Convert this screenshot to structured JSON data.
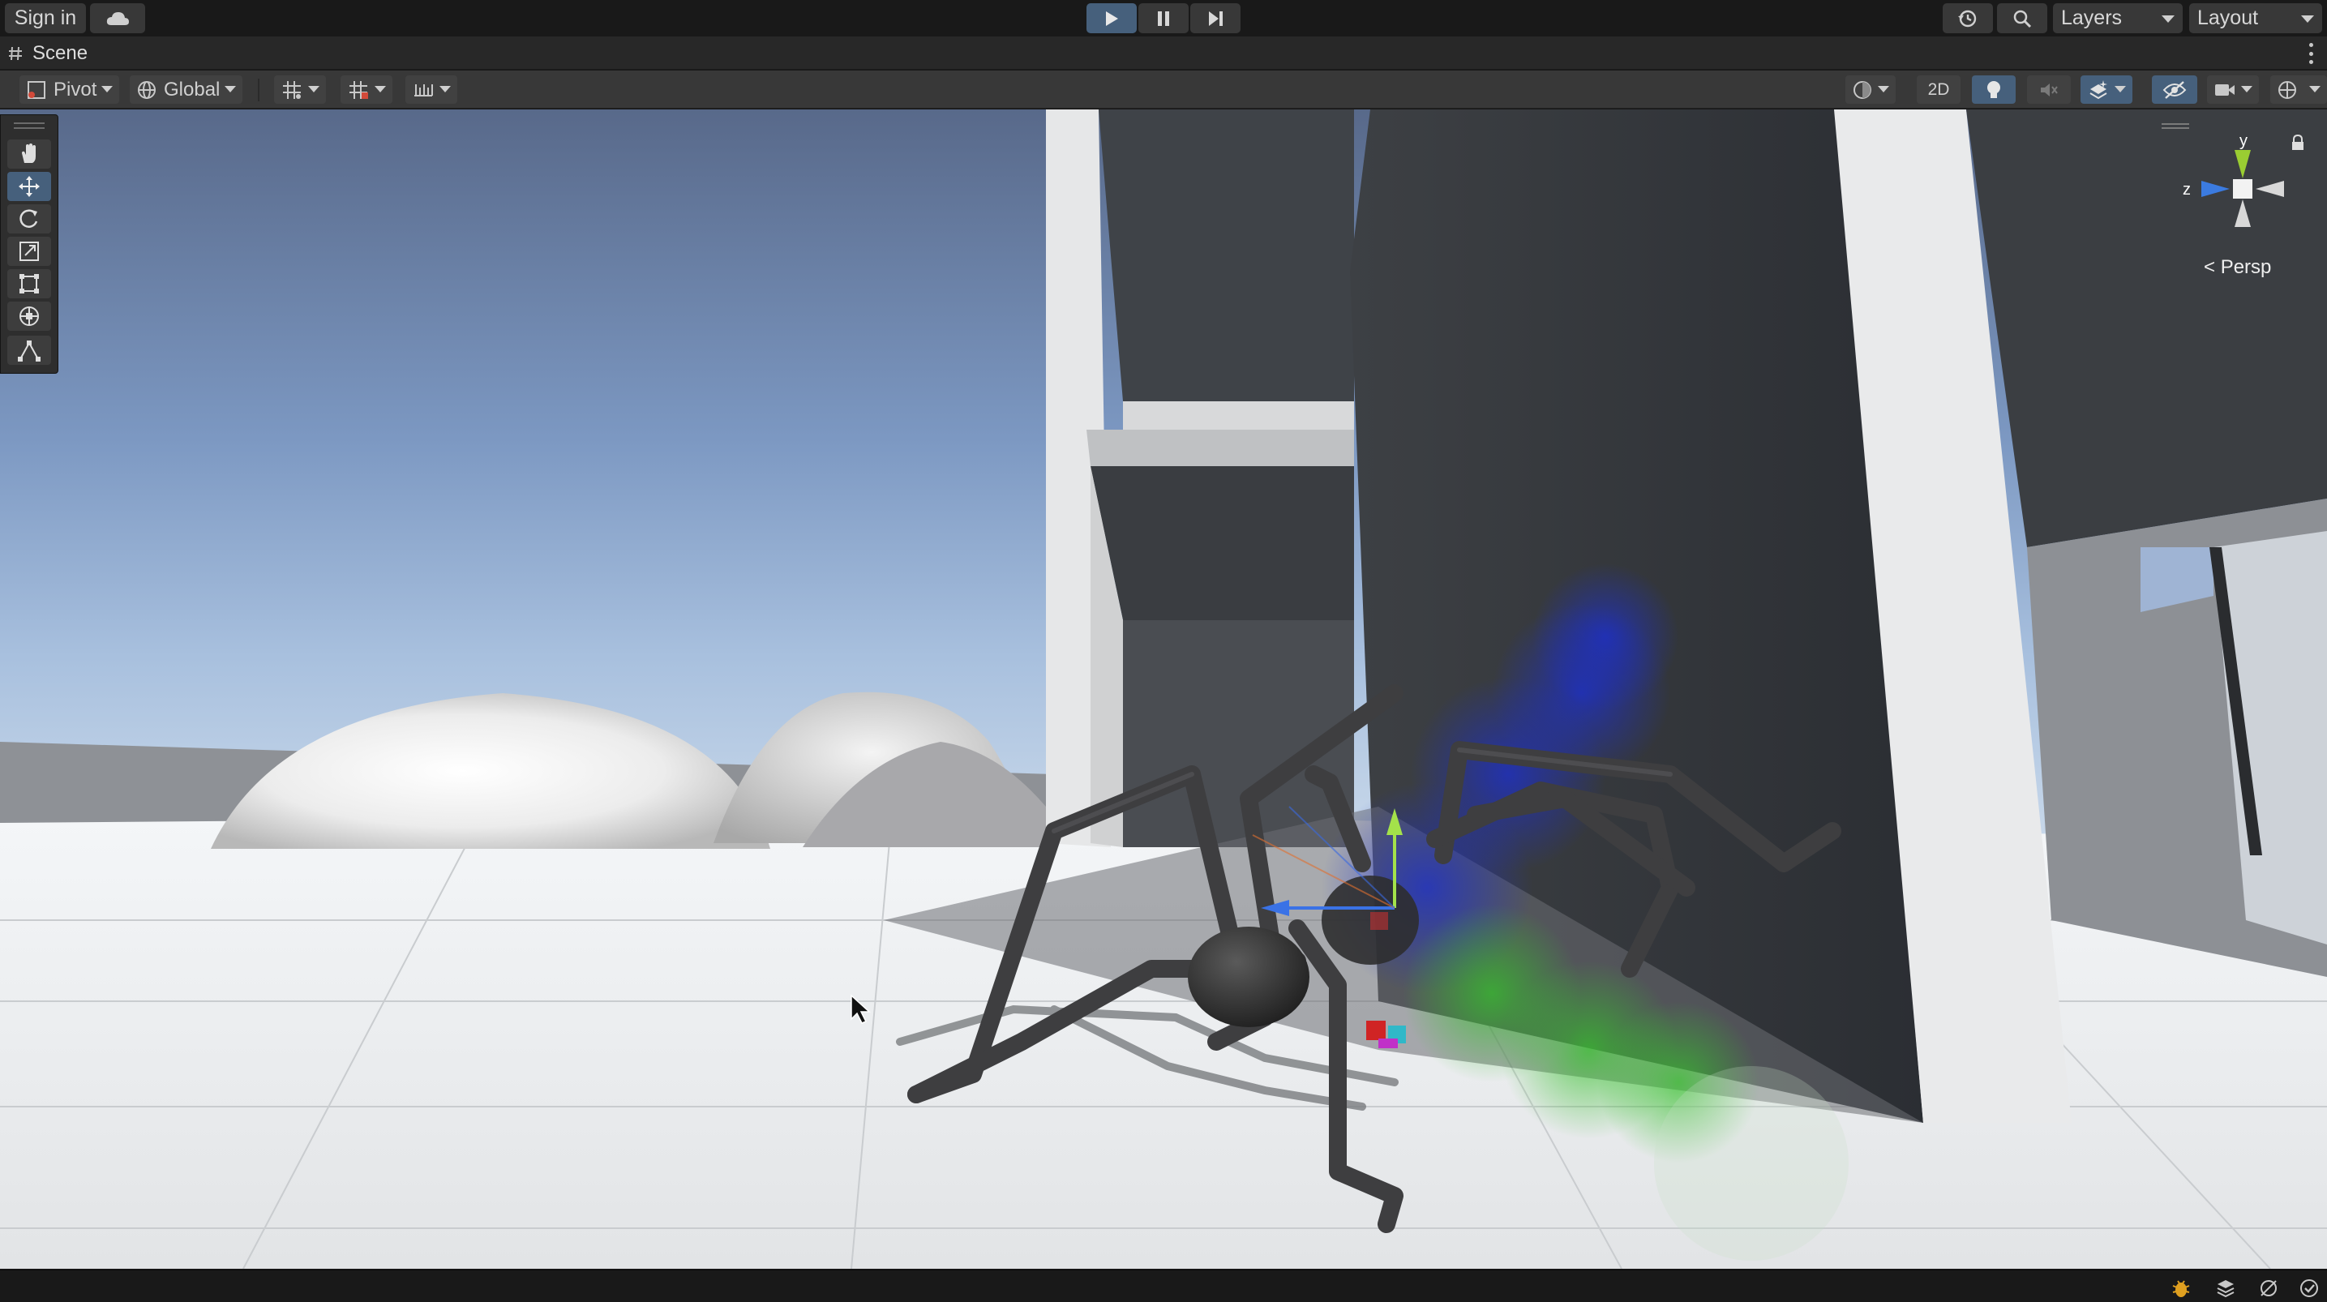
{
  "topbar": {
    "sign_in": "Sign in",
    "cloud_icon": "cloud-icon",
    "play_icon": "play-icon",
    "pause_icon": "pause-icon",
    "step_icon": "step-icon",
    "history_icon": "history-icon",
    "search_icon": "search-icon",
    "layers": "Layers",
    "layout": "Layout",
    "play_active_color": "#46607c"
  },
  "tab": {
    "title": "Scene",
    "icon": "hash-icon"
  },
  "scene_toolbar": {
    "pivot": "Pivot",
    "global": "Global",
    "mode_2d": "2D",
    "icons": [
      "grid-snap-icon",
      "increment-snap-icon",
      "ruler-icon",
      "shading-icon",
      "light-icon",
      "audio-mute-icon",
      "effects-icon",
      "visibility-icon",
      "camera-icon",
      "gizmos-icon"
    ]
  },
  "tools": [
    {
      "name": "hand-tool",
      "icon": "hand-icon"
    },
    {
      "name": "move-tool",
      "icon": "move-icon",
      "active": true
    },
    {
      "name": "rotate-tool",
      "icon": "rotate-icon"
    },
    {
      "name": "scale-tool",
      "icon": "scale-icon"
    },
    {
      "name": "rect-tool",
      "icon": "rect-icon"
    },
    {
      "name": "transform-tool",
      "icon": "transform-icon"
    },
    {
      "name": "custom-tool",
      "icon": "custom-tool-icon"
    }
  ],
  "gizmo": {
    "y_label": "y",
    "z_label": "z",
    "projection": "Persp",
    "y_color": "#9acd32",
    "z_color": "#3b7be0"
  },
  "status": {
    "icons": [
      "debug-bug-icon",
      "layers-stack-icon",
      "network-icon",
      "check-icon"
    ]
  }
}
